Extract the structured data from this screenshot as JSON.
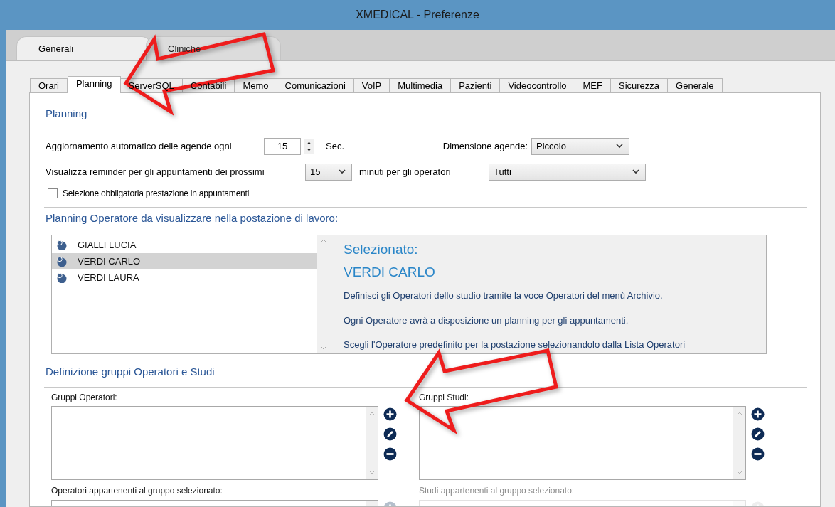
{
  "window": {
    "title": "XMEDICAL - Preferenze"
  },
  "outer_tabs": [
    {
      "label": "Generali",
      "selected": true
    },
    {
      "label": "Cliniche",
      "selected": false
    }
  ],
  "tabs": [
    {
      "label": "Orari",
      "selected": false
    },
    {
      "label": "Planning",
      "selected": true
    },
    {
      "label": "ServerSQL",
      "selected": false
    },
    {
      "label": "Contabili",
      "selected": false
    },
    {
      "label": "Memo",
      "selected": false
    },
    {
      "label": "Comunicazioni",
      "selected": false
    },
    {
      "label": "VoIP",
      "selected": false
    },
    {
      "label": "Multimedia",
      "selected": false
    },
    {
      "label": "Pazienti",
      "selected": false
    },
    {
      "label": "Videocontrollo",
      "selected": false
    },
    {
      "label": "MEF",
      "selected": false
    },
    {
      "label": "Sicurezza",
      "selected": false
    },
    {
      "label": "Generale",
      "selected": false
    }
  ],
  "planning": {
    "heading": "Planning",
    "refresh_label": "Aggiornamento automatico delle agende ogni",
    "refresh_value": "15",
    "refresh_unit": "Sec.",
    "size_label": "Dimensione agende:",
    "size_value": "Piccolo",
    "reminder_label": "Visualizza reminder per gli appuntamenti dei prossimi",
    "reminder_value": "15",
    "reminder_unit": "minuti per gli operatori",
    "operators_value": "Tutti",
    "checkbox": {
      "label": "Selezione obbligatoria prestazione in appuntamenti",
      "checked": false
    }
  },
  "operators": {
    "heading": "Planning Operatore da visualizzare nella postazione di lavoro:",
    "list": [
      {
        "name": "GIALLI LUCIA",
        "selected": false
      },
      {
        "name": "VERDI CARLO",
        "selected": true
      },
      {
        "name": "VERDI LAURA",
        "selected": false
      }
    ],
    "info": {
      "title": "Selezionato:",
      "name": "VERDI CARLO",
      "lines": [
        "Definisci gli Operatori dello studio tramite la voce Operatori del menù Archivio.",
        "Ogni Operatore avrà a disposizione un planning per gli appuntamenti.",
        "Scegli l'Operatore predefinito per la postazione selezionandolo dalla Lista Operatori"
      ]
    }
  },
  "groups": {
    "heading": "Definizione gruppi Operatori e Studi",
    "lists": [
      {
        "label": "Gruppi Operatori:",
        "disabled": false
      },
      {
        "label": "Gruppi Studi:",
        "disabled": false
      }
    ],
    "members": [
      {
        "label": "Operatori appartenenti al gruppo selezionato:",
        "disabled": false,
        "buttons_disabled": true
      },
      {
        "label": "Studi appartenenti al gruppo selezionato:",
        "disabled": true,
        "buttons_disabled": true
      }
    ]
  }
}
